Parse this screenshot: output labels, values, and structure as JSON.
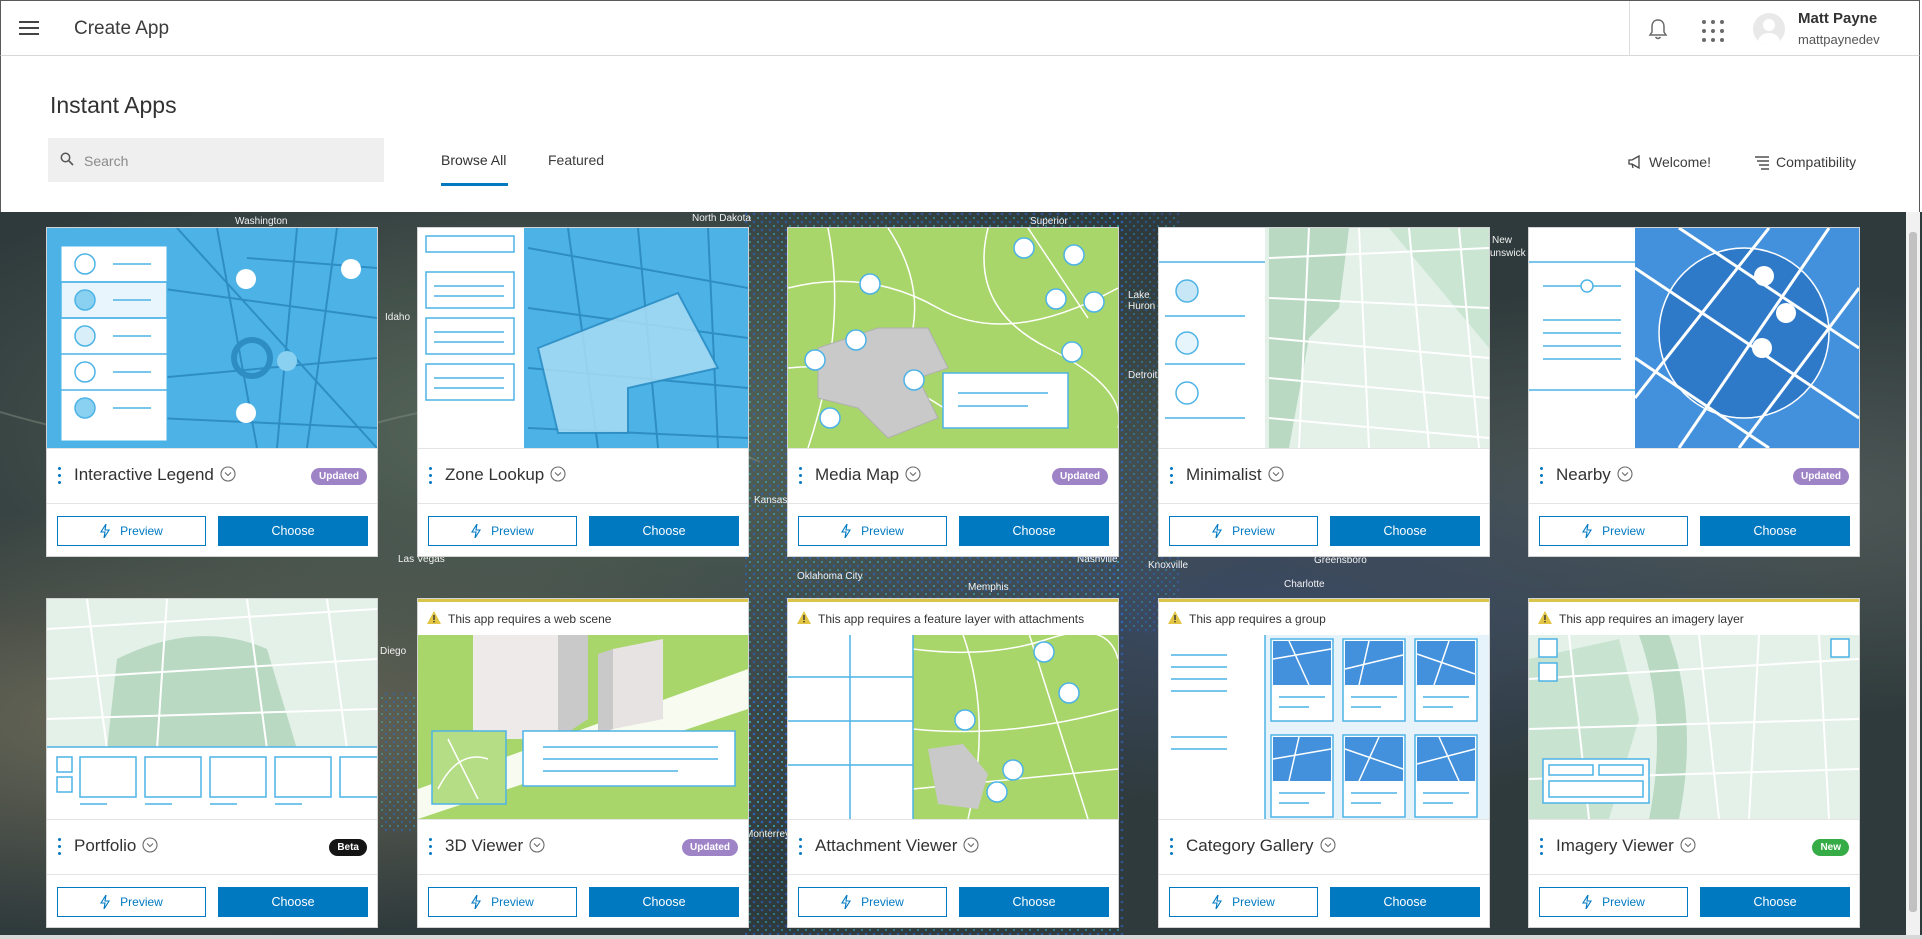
{
  "topbar": {
    "title": "Create App",
    "user_name": "Matt Payne",
    "user_id": "mattpaynedev"
  },
  "header": {
    "title": "Instant Apps",
    "search_placeholder": "Search",
    "tabs": [
      {
        "label": "Browse All",
        "active": true
      },
      {
        "label": "Featured",
        "active": false
      }
    ],
    "links": {
      "welcome": "Welcome!",
      "compatibility": "Compatibility"
    }
  },
  "map_labels": [
    "Washington",
    "North Dakota",
    "Superior",
    "New",
    "Brunswick",
    "Idaho",
    "Lake Huron",
    "Detroit",
    "Kansas",
    "Las Vegas",
    "Oklahoma City",
    "Memphis",
    "Nashville",
    "Knoxville",
    "Greensboro",
    "Charlotte",
    "Diego",
    "Monterrey"
  ],
  "buttons": {
    "preview_label": "Preview",
    "choose_label": "Choose"
  },
  "cards": [
    {
      "title": "Interactive Legend",
      "badge": "Updated",
      "warning": ""
    },
    {
      "title": "Zone Lookup",
      "badge": "",
      "warning": ""
    },
    {
      "title": "Media Map",
      "badge": "Updated",
      "warning": ""
    },
    {
      "title": "Minimalist",
      "badge": "",
      "warning": ""
    },
    {
      "title": "Nearby",
      "badge": "Updated",
      "warning": ""
    },
    {
      "title": "Portfolio",
      "badge": "Beta",
      "warning": ""
    },
    {
      "title": "3D Viewer",
      "badge": "Updated",
      "warning": "This app requires a web scene"
    },
    {
      "title": "Attachment Viewer",
      "badge": "",
      "warning": "This app requires a feature layer with attachments"
    },
    {
      "title": "Category Gallery",
      "badge": "",
      "warning": "This app requires a group"
    },
    {
      "title": "Imagery Viewer",
      "badge": "New",
      "warning": "This app requires an imagery layer"
    }
  ],
  "colors": {
    "accent": "#0079c1",
    "updated_badge": "#9e84c7",
    "beta_badge": "#151515",
    "new_badge": "#35ac46",
    "warning_border": "#d9c549"
  }
}
